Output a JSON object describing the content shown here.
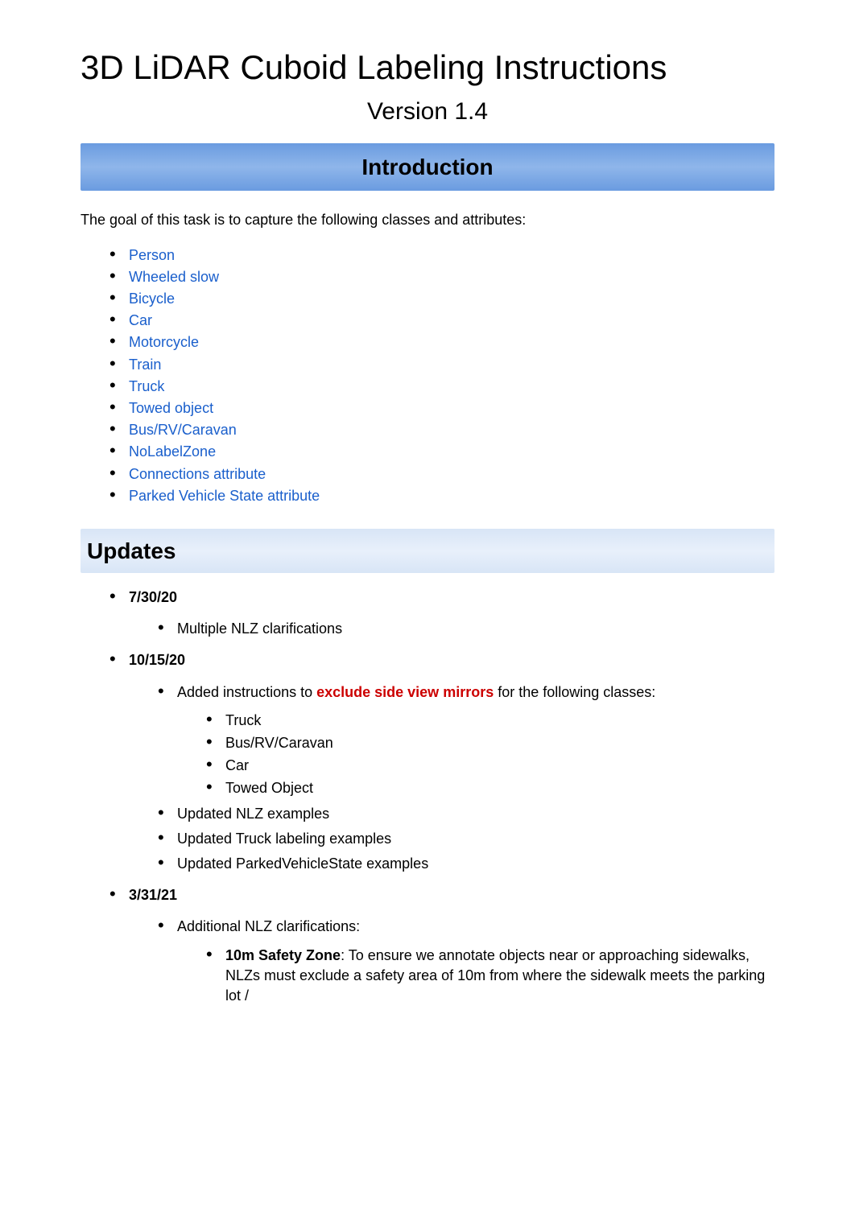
{
  "title": "3D LiDAR Cuboid Labeling Instructions",
  "version": "Version 1.4",
  "introduction_heading": "Introduction",
  "introduction_text": "The goal of this task is to capture the following classes and attributes:",
  "classes": [
    "Person",
    "Wheeled slow",
    "Bicycle",
    "Car",
    "Motorcycle",
    "Train",
    "Truck",
    "Towed object",
    "Bus/RV/Caravan",
    "NoLabelZone",
    "Connections attribute",
    "Parked Vehicle State attribute"
  ],
  "updates_heading": "Updates",
  "updates": [
    {
      "date": "7/30/20",
      "items": [
        {
          "text": "Multiple NLZ clarifications"
        }
      ]
    },
    {
      "date": "10/15/20",
      "items": [
        {
          "prefix": "Added instructions to ",
          "highlight": "exclude side view mirrors",
          "suffix": " for the following classes:",
          "sub": [
            "Truck",
            "Bus/RV/Caravan",
            "Car",
            "Towed Object"
          ]
        },
        {
          "text": "Updated NLZ examples"
        },
        {
          "text": "Updated Truck labeling examples"
        },
        {
          "text": "Updated ParkedVehicleState examples"
        }
      ]
    },
    {
      "date": "3/31/21",
      "items": [
        {
          "text": "Additional NLZ clarifications:",
          "sub_bold_prefix": "10m Safety Zone",
          "sub_rest": ": To ensure we annotate objects near or approaching sidewalks, NLZs must exclude a safety area of 10m from where the sidewalk meets the parking lot /"
        }
      ]
    }
  ]
}
